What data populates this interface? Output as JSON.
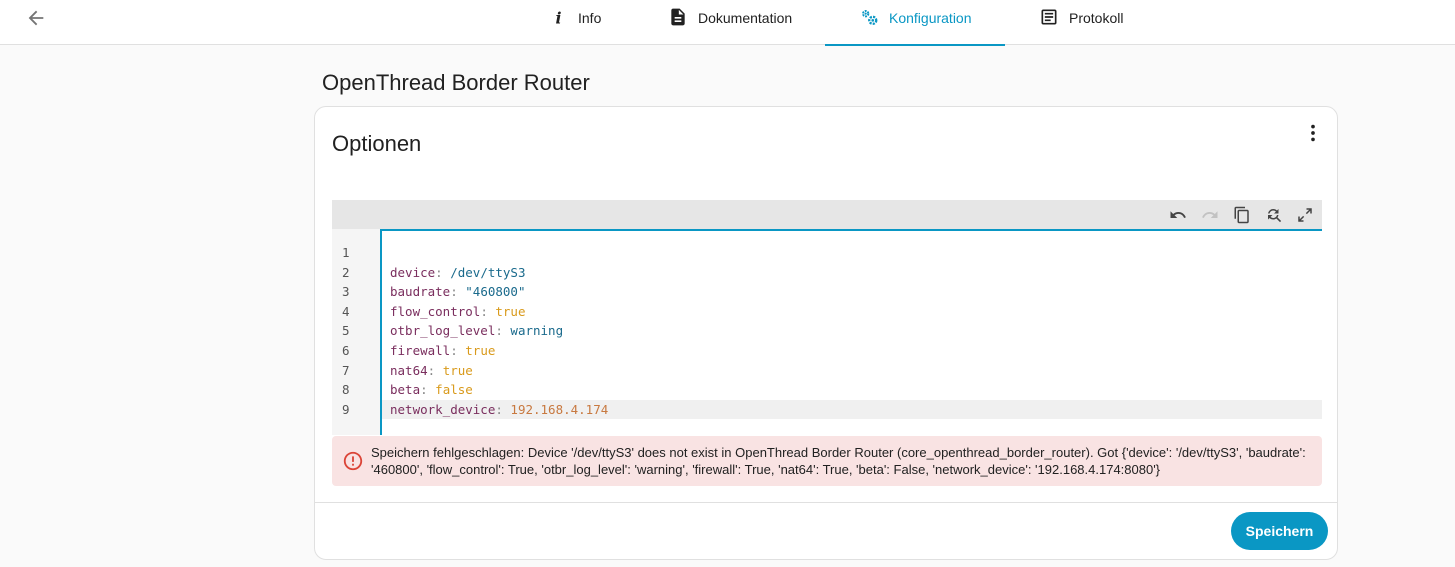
{
  "tabs": [
    {
      "label": "Info",
      "icon": "info-icon"
    },
    {
      "label": "Dokumentation",
      "icon": "document-icon"
    },
    {
      "label": "Konfiguration",
      "icon": "cogs-icon",
      "active": true
    },
    {
      "label": "Protokoll",
      "icon": "log-icon"
    }
  ],
  "page": {
    "title": "OpenThread Border Router"
  },
  "card": {
    "title": "Optionen",
    "save_label": "Speichern"
  },
  "editor": {
    "line_numbers": [
      "1",
      "2",
      "3",
      "4",
      "5",
      "6",
      "7",
      "8",
      "9"
    ],
    "lines": [
      {
        "key": "",
        "value": "",
        "type": "empty"
      },
      {
        "key": "device",
        "value": "/dev/ttyS3",
        "type": "str"
      },
      {
        "key": "baudrate",
        "value": "\"460800\"",
        "type": "str"
      },
      {
        "key": "flow_control",
        "value": "true",
        "type": "bool"
      },
      {
        "key": "otbr_log_level",
        "value": "warning",
        "type": "str"
      },
      {
        "key": "firewall",
        "value": "true",
        "type": "bool"
      },
      {
        "key": "nat64",
        "value": "true",
        "type": "bool"
      },
      {
        "key": "beta",
        "value": "false",
        "type": "bool"
      },
      {
        "key": "network_device",
        "value": "192.168.4.174",
        "type": "num"
      }
    ]
  },
  "error": {
    "message": "Speichern fehlgeschlagen: Device '/dev/ttyS3' does not exist in OpenThread Border Router (core_openthread_border_router). Got {'device': '/dev/ttyS3', 'baudrate': '460800', 'flow_control': True, 'otbr_log_level': 'warning', 'firewall': True, 'nat64': True, 'beta': False, 'network_device': '192.168.4.174:8080'}"
  },
  "colors": {
    "accent": "#0a97c4",
    "error_bg": "#f9e3e3",
    "error_icon": "#db4437"
  }
}
